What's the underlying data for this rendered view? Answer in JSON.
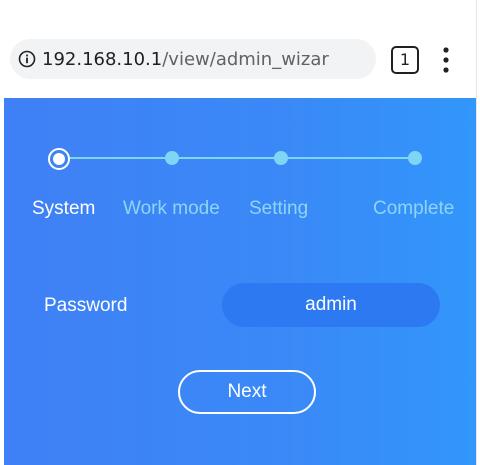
{
  "browser": {
    "url_host": "192.168.10.1",
    "url_path": "/view/admin_wizar",
    "tab_count": "1"
  },
  "wizard": {
    "steps": [
      {
        "label": "System",
        "state": "current"
      },
      {
        "label": "Work mode",
        "state": "pending"
      },
      {
        "label": "Setting",
        "state": "pending"
      },
      {
        "label": "Complete",
        "state": "pending"
      }
    ],
    "password_label": "Password",
    "password_value": "admin",
    "next_label": "Next"
  },
  "colors": {
    "background_start": "#3f80f6",
    "background_end": "#3296fb",
    "step_inactive": "#7fd6f4",
    "input_bg": "#2c79f1",
    "text": "#ffffff"
  }
}
